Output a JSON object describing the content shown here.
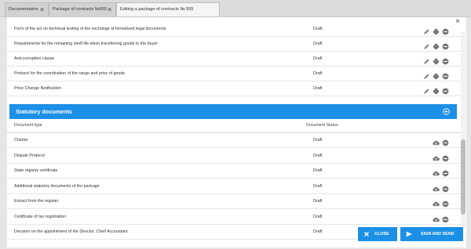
{
  "tabs": [
    {
      "label": "Documentation",
      "close": "✕"
    },
    {
      "label": "Package of contracts №555",
      "close": "✕"
    },
    {
      "label": "Editing a package of contracts № 555",
      "close": ""
    }
  ],
  "dialog": {
    "close_symbol": "×"
  },
  "contract_docs": {
    "rows": [
      {
        "name": "Form of the act on technical testing of the exchange of formalized legal documents",
        "status": "Draft"
      },
      {
        "name": "Requirements for the remaining shelf life when transferring goods to the buyer",
        "status": "Draft"
      },
      {
        "name": "Anti-corruption clause",
        "status": "Draft"
      },
      {
        "name": "Protocol for the coordination of the range and price of goods",
        "status": "Draft"
      },
      {
        "name": "Price Change Notification",
        "status": "Draft"
      }
    ]
  },
  "statutory": {
    "title": "Statutory documents",
    "col_type": "Document type",
    "col_status": "Document Status",
    "rows": [
      {
        "name": "Charter",
        "status": "Draft"
      },
      {
        "name": "Dispute Protocol",
        "status": "Draft"
      },
      {
        "name": "State registry certificate",
        "status": "Draft"
      },
      {
        "name": "Additional statutory documents of the package",
        "status": "Draft"
      },
      {
        "name": "Extract from the register",
        "status": "Draft"
      },
      {
        "name": "Certificate of tax registration",
        "status": "Draft"
      },
      {
        "name": "Decision on the appointment of the Director, Chief Accountant",
        "status": "Draft"
      }
    ]
  },
  "footer": {
    "close_label": "CLOSE",
    "sign_label": "SIGN AND SEND"
  },
  "colors": {
    "accent": "#1c8fe6",
    "icon_gray": "#757575"
  }
}
